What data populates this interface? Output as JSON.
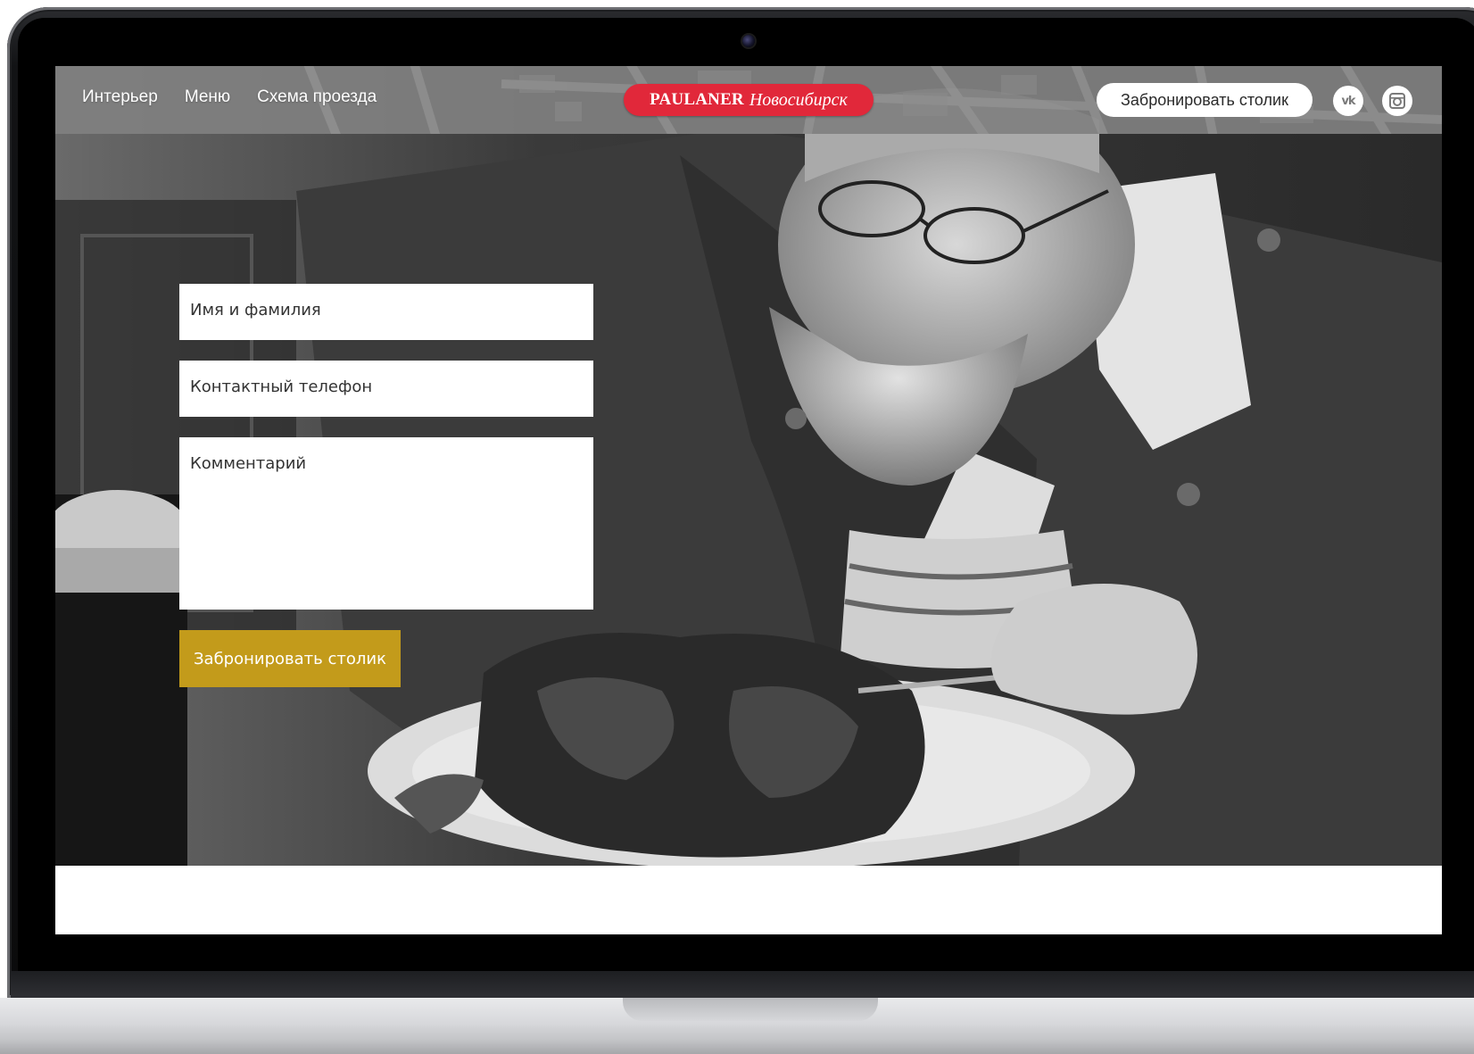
{
  "header": {
    "nav": [
      {
        "label": "Интерьер"
      },
      {
        "label": "Меню"
      },
      {
        "label": "Схема проезда"
      }
    ],
    "logo": {
      "brand": "PAULANER",
      "city": "Новосибирск"
    },
    "book_button": "Забронировать столик",
    "social": [
      {
        "icon": "vk-icon",
        "label": "vk"
      },
      {
        "icon": "instagram-icon"
      }
    ]
  },
  "form": {
    "name_placeholder": "Имя и фамилия",
    "phone_placeholder": "Контактный телефон",
    "comment_placeholder": "Комментарий",
    "submit_label": "Забронировать  столик"
  },
  "colors": {
    "logo_red": "#e1283a",
    "submit_gold": "#c39b1b",
    "header_gray": "#808080"
  }
}
